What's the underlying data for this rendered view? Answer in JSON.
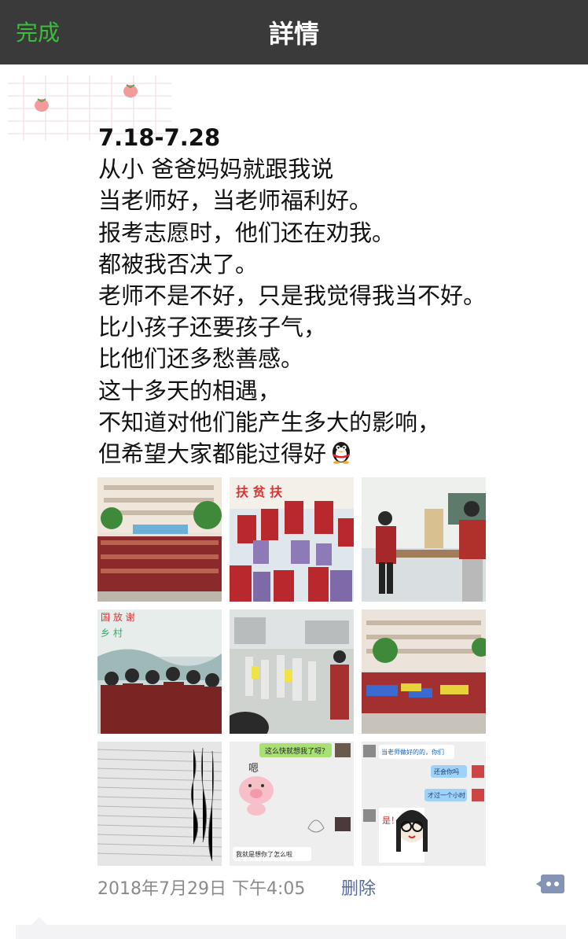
{
  "navbar": {
    "done_label": "完成",
    "title": "詳情",
    "done_color": "#3bbf3b",
    "background": "#3a3a3a"
  },
  "post": {
    "lines": [
      "7.18-7.28",
      "从小 爸爸妈妈就跟我说",
      "当老师好，当老师福利好。",
      "报考志愿时，他们还在劝我。",
      "都被我否决了。",
      "老师不是不好，只是我觉得我当不好。",
      "比小孩子还要孩子气，",
      "比他们还多愁善感。",
      "这十多天的相遇，",
      "不知道对他们能产生多大的影响，",
      "但希望大家都能过得好"
    ],
    "end_icon": "penguin-emoji",
    "photos": [
      {
        "name": "photo-school-group",
        "icon": "group-photo-school"
      },
      {
        "name": "photo-volunteers-stage",
        "icon": "group-photo-stage"
      },
      {
        "name": "photo-classroom-pose",
        "icon": "classroom-photo"
      },
      {
        "name": "photo-mural-group",
        "icon": "mural-group-photo"
      },
      {
        "name": "photo-students-courtyard",
        "icon": "courtyard-photo"
      },
      {
        "name": "photo-assembly",
        "icon": "assembly-photo"
      },
      {
        "name": "photo-handwritten-letter",
        "icon": "letter-photo"
      },
      {
        "name": "photo-chat-pig",
        "icon": "chat-screenshot"
      },
      {
        "name": "photo-chat-cartoon",
        "icon": "chat-screenshot"
      }
    ],
    "chat_pig": {
      "bubble_top": "这么快就想我了呀？",
      "sticker_text": "嗯",
      "bubble_bottom": "我就是想你了怎么啦"
    },
    "chat_cartoon": {
      "bubble_1": "当老师做好的的，你们",
      "bubble_2": "还会你吗",
      "bubble_3": "才过一个小时",
      "sticker_text": "是！"
    },
    "timestamp": "2018年7月29日 下午4:05",
    "delete_label": "删除",
    "link_color": "#576b95"
  }
}
